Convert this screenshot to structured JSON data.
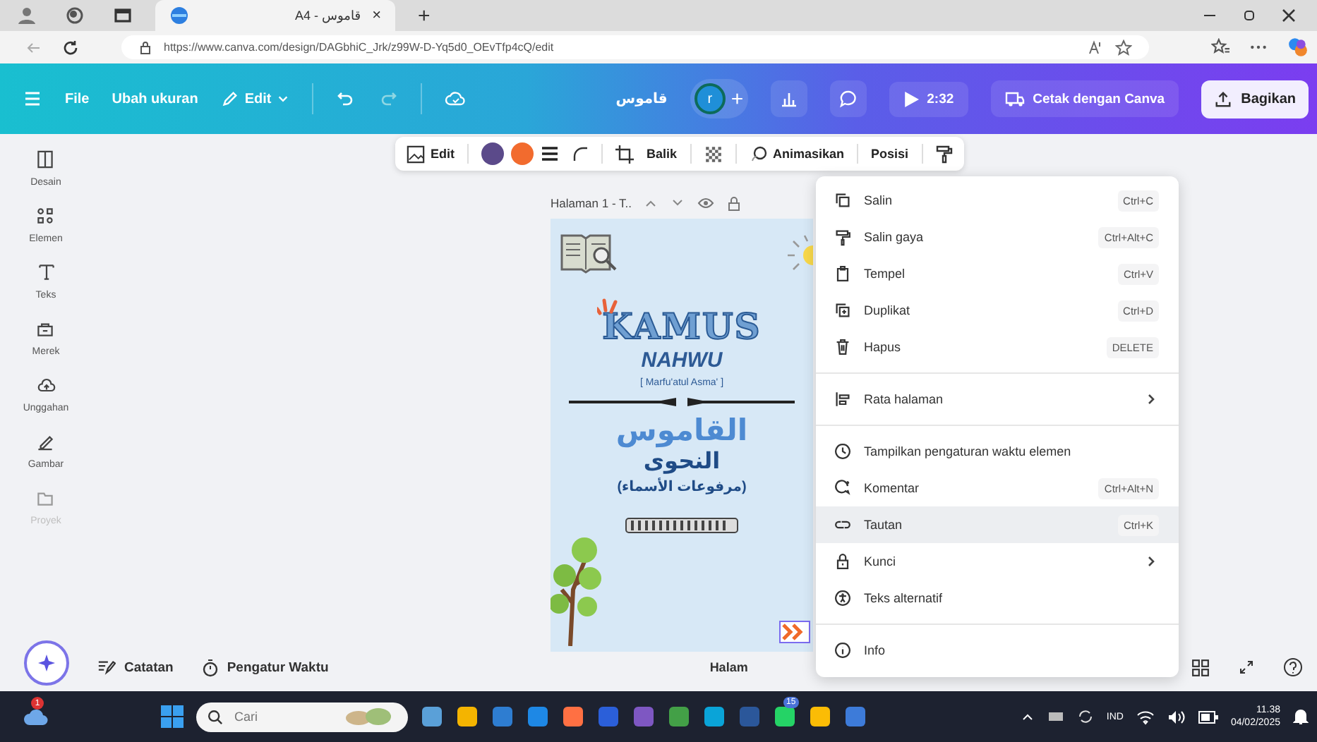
{
  "browser": {
    "tab_title": "A4 - قاموس",
    "tab_close": "×",
    "new_tab": "+",
    "url": "https://www.canva.com/design/DAGbhiC_Jrk/z99W-D-Yq5d0_OEvTfp4cQ/edit"
  },
  "header": {
    "file": "File",
    "resize": "Ubah ukuran",
    "edit": "Edit",
    "doc_title": "قاموس",
    "avatar": "r",
    "add": "+",
    "timer": "2:32",
    "print": "Cetak dengan Canva",
    "share": "Bagikan"
  },
  "sidebar": {
    "items": [
      {
        "label": "Desain",
        "disabled": false
      },
      {
        "label": "Elemen",
        "disabled": false
      },
      {
        "label": "Teks",
        "disabled": false
      },
      {
        "label": "Merek",
        "disabled": false
      },
      {
        "label": "Unggahan",
        "disabled": false
      },
      {
        "label": "Gambar",
        "disabled": false
      },
      {
        "label": "Proyek",
        "disabled": true
      }
    ]
  },
  "toolbar": {
    "edit": "Edit",
    "colors": [
      {
        "color": "#5b4a8a"
      },
      {
        "color": "#f26b2e"
      }
    ],
    "flip": "Balik",
    "animate": "Animasikan",
    "position": "Posisi"
  },
  "page": {
    "label": "Halaman 1 - T..",
    "title": "KAMUS",
    "subtitle": "NAHWU",
    "note": "[ Marfu'atul Asma' ]",
    "arabic_title": "القاموس",
    "arabic_subtitle": "النحوى",
    "arabic_note": "(مرفوعات الأسماء)"
  },
  "footer": {
    "notes": "Catatan",
    "timer": "Pengatur Waktu",
    "page_label": "Halam"
  },
  "context_menu": {
    "groups": [
      {
        "items": [
          {
            "label": "Salin",
            "shortcut": "Ctrl+C",
            "has_submenu": false,
            "selected": false
          },
          {
            "label": "Salin gaya",
            "shortcut": "Ctrl+Alt+C",
            "has_submenu": false,
            "selected": false
          },
          {
            "label": "Tempel",
            "shortcut": "Ctrl+V",
            "has_submenu": false,
            "selected": false
          },
          {
            "label": "Duplikat",
            "shortcut": "Ctrl+D",
            "has_submenu": false,
            "selected": false
          },
          {
            "label": "Hapus",
            "shortcut": "DELETE",
            "has_submenu": false,
            "selected": false
          }
        ]
      },
      {
        "items": [
          {
            "label": "Rata halaman",
            "has_submenu": true,
            "selected": false
          }
        ]
      },
      {
        "items": [
          {
            "label": "Tampilkan pengaturan waktu elemen",
            "has_submenu": false,
            "selected": false
          },
          {
            "label": "Komentar",
            "shortcut": "Ctrl+Alt+N",
            "has_submenu": false,
            "selected": false
          },
          {
            "label": "Tautan",
            "shortcut": "Ctrl+K",
            "has_submenu": false,
            "selected": true
          },
          {
            "label": "Kunci",
            "has_submenu": true,
            "selected": false
          },
          {
            "label": "Teks alternatif",
            "has_submenu": false,
            "selected": false
          }
        ]
      },
      {
        "items": [
          {
            "label": "Info",
            "has_submenu": false,
            "selected": false
          }
        ]
      }
    ]
  },
  "taskbar": {
    "weather_badge": "1",
    "search_placeholder": "Cari",
    "chat_badge": "15",
    "language": "IND",
    "time": "11.38",
    "date": "04/02/2025"
  }
}
